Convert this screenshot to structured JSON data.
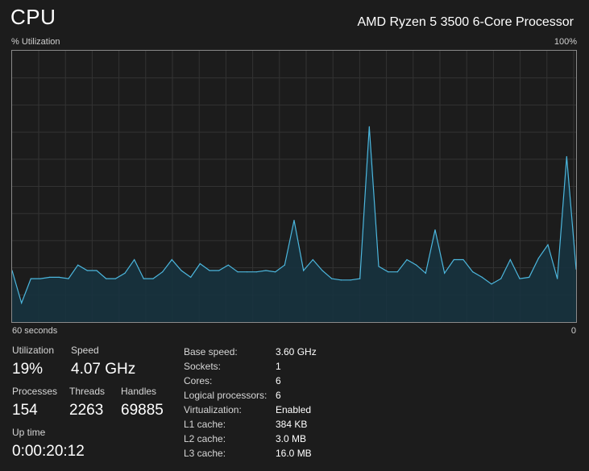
{
  "header": {
    "title": "CPU",
    "processor_name": "AMD Ryzen 5 3500 6-Core Processor"
  },
  "graph": {
    "y_label": "% Utilization",
    "y_max_label": "100%",
    "x_label_left": "60 seconds",
    "x_label_right": "0",
    "line_color": "#4cb7de",
    "fill_color": "#17333f",
    "grid_color": "#333333",
    "border_color": "#8a8a8a"
  },
  "chart_data": {
    "type": "area",
    "xlabel": "",
    "ylabel": "% Utilization",
    "xlim": [
      60,
      0
    ],
    "ylim": [
      0,
      100
    ],
    "grid": true,
    "series": [
      {
        "values": [
          19,
          7,
          16,
          16,
          16.5,
          16.5,
          16,
          21,
          19,
          19,
          16,
          16,
          18,
          23,
          16,
          16,
          18.5,
          23,
          19,
          16.5,
          21.5,
          19,
          19,
          21,
          18.5,
          18.5,
          18.5,
          19,
          18.5,
          21,
          37.5,
          19,
          23,
          19,
          16,
          15.5,
          15.5,
          16,
          72,
          20.5,
          18.5,
          18.5,
          23,
          21,
          18,
          34,
          18,
          23,
          23,
          18.5,
          16.5,
          14,
          16,
          23,
          16,
          16.5,
          23.5,
          28.5,
          16,
          61,
          19.5
        ]
      }
    ]
  },
  "stats": {
    "utilization": {
      "label": "Utilization",
      "value": "19%"
    },
    "speed": {
      "label": "Speed",
      "value": "4.07 GHz"
    },
    "processes": {
      "label": "Processes",
      "value": "154"
    },
    "threads": {
      "label": "Threads",
      "value": "2263"
    },
    "handles": {
      "label": "Handles",
      "value": "69885"
    },
    "uptime": {
      "label": "Up time",
      "value": "0:00:20:12"
    }
  },
  "info": {
    "base_speed": {
      "label": "Base speed:",
      "value": "3.60 GHz"
    },
    "sockets": {
      "label": "Sockets:",
      "value": "1"
    },
    "cores": {
      "label": "Cores:",
      "value": "6"
    },
    "logical": {
      "label": "Logical processors:",
      "value": "6"
    },
    "virtualization": {
      "label": "Virtualization:",
      "value": "Enabled"
    },
    "l1": {
      "label": "L1 cache:",
      "value": "384 KB"
    },
    "l2": {
      "label": "L2 cache:",
      "value": "3.0 MB"
    },
    "l3": {
      "label": "L3 cache:",
      "value": "16.0 MB"
    }
  }
}
